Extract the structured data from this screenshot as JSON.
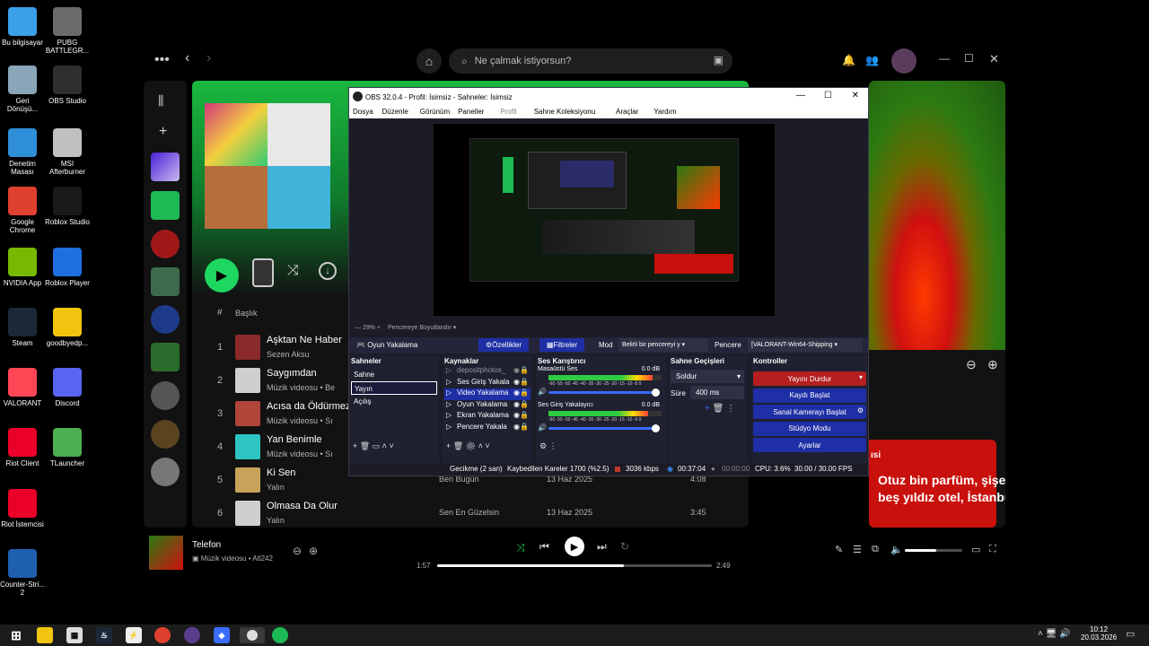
{
  "desktop": {
    "icons": [
      {
        "label": "Bu bilgisayar",
        "icon": "computer-icon",
        "color": "#3aa0e8"
      },
      {
        "label": "Geri Dönüşü...",
        "icon": "recycle-bin-icon",
        "color": "#8aa4b8"
      },
      {
        "label": "Denetim Masası",
        "icon": "control-panel-icon",
        "color": "#2f8fd8"
      },
      {
        "label": "Google Chrome",
        "icon": "chrome-icon",
        "color": "#e0412f"
      },
      {
        "label": "NVIDIA App",
        "icon": "nvidia-icon",
        "color": "#76b900"
      },
      {
        "label": "Steam",
        "icon": "steam-icon",
        "color": "#1b2838"
      },
      {
        "label": "VALORANT",
        "icon": "valorant-icon",
        "color": "#ff4655"
      },
      {
        "label": "Riot Client",
        "icon": "riot-icon",
        "color": "#eb0029"
      },
      {
        "label": "Riot İstemcisi",
        "icon": "riot-icon",
        "color": "#eb0029"
      },
      {
        "label": "Counter-Stri... 2",
        "icon": "cs2-icon",
        "color": "#1e5fb0"
      }
    ],
    "icons2": [
      {
        "label": "PUBG BATTLEGR...",
        "icon": "pubg-icon",
        "color": "#6b6b6b"
      },
      {
        "label": "OBS Studio",
        "icon": "obs-icon",
        "color": "#302e31"
      },
      {
        "label": "MSI Afterburner",
        "icon": "msi-icon",
        "color": "#c0c0c0"
      },
      {
        "label": "Roblox Studio",
        "icon": "roblox-studio-icon",
        "color": "#1a1a1a"
      },
      {
        "label": "Roblox Player",
        "icon": "roblox-icon",
        "color": "#1f6fe0"
      },
      {
        "label": "goodbyedp...",
        "icon": "folder-icon",
        "color": "#f1c40f"
      },
      {
        "label": "Discord",
        "icon": "discord-icon",
        "color": "#5865f2"
      },
      {
        "label": "TLauncher",
        "icon": "tlauncher-icon",
        "color": "#4caf50"
      }
    ]
  },
  "spotify": {
    "search_placeholder": "Ne çalmak istiyorsun?",
    "table_header_num": "#",
    "table_header_title": "Başlık",
    "tracks": [
      {
        "num": "1",
        "title": "Aşktan Ne Haber",
        "artist": "Sezen Aksu",
        "album": "",
        "date": "",
        "duration": "",
        "color": "#8a2a2a"
      },
      {
        "num": "2",
        "title": "Saygımdan",
        "artist": "Müzik videosu • Be",
        "album": "",
        "date": "",
        "duration": "",
        "color": "#cfcfcf"
      },
      {
        "num": "3",
        "title": "Acısa da Öldürmez",
        "artist": "Müzik videosu • Sı",
        "album": "",
        "date": "",
        "duration": "",
        "color": "#b0453a"
      },
      {
        "num": "4",
        "title": "Yan Benimle",
        "artist": "Müzik videosu • Sı",
        "album": "",
        "date": "",
        "duration": "",
        "color": "#2ec4c4"
      },
      {
        "num": "5",
        "title": "Ki Sen",
        "artist": "Yalın",
        "album": "Ben Bugün",
        "date": "13 Haz 2025",
        "duration": "4:08",
        "color": "#c9a35c"
      },
      {
        "num": "6",
        "title": "Olmasa Da Olur",
        "artist": "Yalın",
        "album": "Sen En Güzelsin",
        "date": "13 Haz 2025",
        "duration": "3:45",
        "color": "#cfcfcf"
      }
    ],
    "right_panel": {
      "banner_small": "ısi",
      "banner_text": "Otuz bin parfüm, şişe ve pipe'; beş yıldız otel, İstanbul city"
    },
    "player": {
      "title": "Telefon",
      "subtitle": "Müzik videosu • Atl242",
      "elapsed": "1:57",
      "total": "2:49",
      "progress": 0.68,
      "volume": 0.55
    }
  },
  "obs": {
    "title": "OBS 32.0.4 - Profil: İsimsiz - Sahneler: İsimsiz",
    "menu": [
      "Dosya",
      "Düzenle",
      "Görünüm",
      "Paneller",
      "Profil",
      "Sahne Koleksiyonu",
      "Araçlar",
      "Yardım"
    ],
    "zoom": "29%",
    "fit_label": "Pencereye Boyutlandır",
    "source_label": "Oyun Yakalama",
    "properties_btn": "Özellikler",
    "filters_btn": "Filtreler",
    "mode_label": "Mod",
    "mode_value": "Belirli bir pencereyi y",
    "window_label": "Pencere",
    "window_value": "[VALORANT-Win64-Shipping",
    "scenes_title": "Sahneler",
    "scenes": [
      "Sahne",
      "Yayın",
      "Açılış"
    ],
    "sources_title": "Kaynaklar",
    "sources": [
      "depositphotos_",
      "Ses Giriş Yakala",
      "Video Yakalama",
      "Oyun Yakalama",
      "Ekran Yakalama",
      "Pencere Yakala"
    ],
    "mixer_title": "Ses Karıştırıcı",
    "mixer": [
      {
        "name": "Masaüstü Ses",
        "db": "0.0 dB",
        "level": 0.92
      },
      {
        "name": "Ses Giriş Yakalayıcı",
        "db": "0.0 dB",
        "level": 0.88
      }
    ],
    "mixer_scale": "-60 -55 -50 -45 -40 -35 -30 -25 -20 -15 -10 -5 0",
    "transitions_title": "Sahne Geçişleri",
    "transition_value": "Soldur",
    "duration_label": "Süre",
    "duration_value": "400 ms",
    "controls_title": "Kontroller",
    "controls": [
      "Yayını Durdur",
      "Kaydı Başlat",
      "Sanal Kamerayı Başlat",
      "Stüdyo Modu",
      "Ayarlar"
    ],
    "status": {
      "delay": "Gecikme (2 san)",
      "dropped": "Kaybedilen Kareler 1700 (%2.5)",
      "bitrate": "3036 kbps",
      "live_time": "00:37:04",
      "rec_time": "00:00:00",
      "cpu": "CPU: 3.6%",
      "fps": "30.00 / 30.00 FPS"
    }
  },
  "taskbar": {
    "time": "10:12",
    "date": "20.03.2026"
  }
}
